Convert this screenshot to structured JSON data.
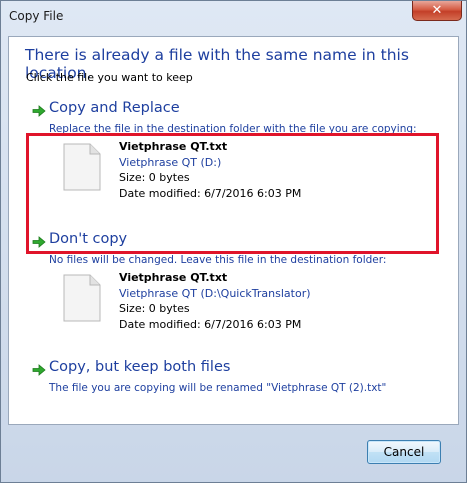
{
  "window": {
    "title": "Copy File",
    "close_symbol": "✕"
  },
  "heading": "There is already a file with the same name in this location.",
  "subheading": "Click the file you want to keep",
  "options": [
    {
      "title": "Copy and Replace",
      "description": "Replace the file in the destination folder with the file you are copying:",
      "file": {
        "name": "Vietphrase QT.txt",
        "path": "Vietphrase QT (D:)",
        "size": "Size: 0 bytes",
        "date": "Date modified: 6/7/2016 6:03 PM"
      }
    },
    {
      "title": "Don't copy",
      "description": "No files will be changed. Leave this file in the destination folder:",
      "file": {
        "name": "Vietphrase QT.txt",
        "path": "Vietphrase QT (D:\\QuickTranslator)",
        "size": "Size: 0 bytes",
        "date": "Date modified: 6/7/2016 6:03 PM"
      }
    },
    {
      "title": "Copy, but keep both files",
      "description": "The file you are copying will be renamed \"Vietphrase QT (2).txt\""
    }
  ],
  "buttons": {
    "cancel": "Cancel"
  },
  "colors": {
    "link_blue": "#1e3f9f",
    "highlight_red": "#e0142a",
    "arrow_green": "#2fa82f"
  },
  "icons": {
    "option_arrow": "green-right-arrow-icon",
    "file": "text-file-icon",
    "close": "close-icon"
  }
}
